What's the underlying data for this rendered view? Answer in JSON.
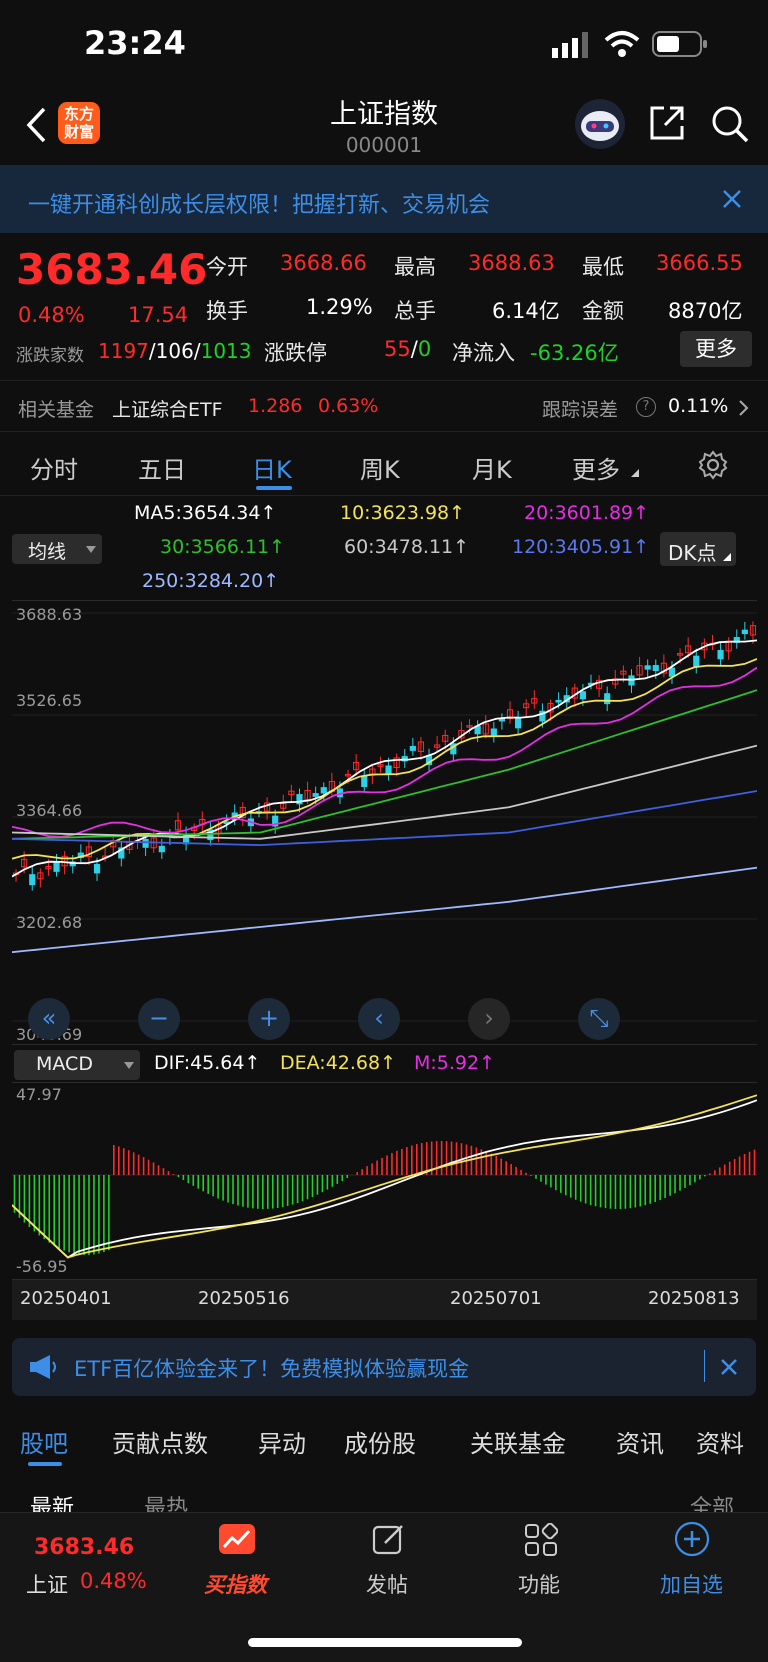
{
  "status": {
    "time": "23:24"
  },
  "header": {
    "logo_text": "东方财富",
    "title": "上证指数",
    "code": "000001"
  },
  "banner": {
    "text": "一键开通科创成长层权限！把握打新、交易机会"
  },
  "quote": {
    "price": "3683.46",
    "change_pct": "0.48%",
    "change": "17.54",
    "open_label": "今开",
    "open": "3668.66",
    "high_label": "最高",
    "high": "3688.63",
    "low_label": "最低",
    "low": "3666.55",
    "turnover_label": "换手",
    "turnover": "1.29%",
    "volume_label": "总手",
    "volume": "6.14亿",
    "amount_label": "金额",
    "amount": "8870亿",
    "breadth_label": "涨跌家数",
    "up": "1197",
    "flat": "106",
    "down": "1013",
    "limit_label": "涨跌停",
    "limit_up": "55",
    "limit_down": "0",
    "slash": "/",
    "netflow_label": "净流入",
    "netflow": "-63.26亿",
    "more": "更多"
  },
  "fund": {
    "label": "相关基金",
    "name": "上证综合ETF",
    "price": "1.286",
    "pct": "0.63%",
    "error_label": "跟踪误差",
    "error": "0.11%"
  },
  "tabs": [
    "分时",
    "五日",
    "日K",
    "周K",
    "月K",
    "更多"
  ],
  "ma": {
    "selector": "均线",
    "dk": "DK点",
    "ma5": "MA5:3654.34↑",
    "ma10": "10:3623.98↑",
    "ma20": "20:3601.89↑",
    "ma30": "30:3566.11↑",
    "ma60": "60:3478.11↑",
    "ma120": "120:3405.91↑",
    "ma250": "250:3284.20↑"
  },
  "colors": {
    "ma5": "#ffffff",
    "ma10": "#f3e35a",
    "ma20": "#e330e3",
    "ma30": "#2fbf2f",
    "ma60": "#c8c8c8",
    "ma120": "#3f5fe0",
    "ma250": "#9fb8ff",
    "up": "#ff2b2b",
    "down": "#1fd12a",
    "accent": "#3d8ee6"
  },
  "kline_axis": [
    "3688.63",
    "3526.65",
    "3364.66",
    "3202.68",
    "3040.69"
  ],
  "macd": {
    "selector": "MACD",
    "dif": "DIF:45.64↑",
    "dea": "DEA:42.68↑",
    "m": "M:5.92↑",
    "top": "47.97",
    "bottom": "-56.95"
  },
  "dates": [
    "20250401",
    "20250516",
    "20250701",
    "20250813"
  ],
  "chart_data": {
    "type": "line",
    "title": "",
    "xlabel": "",
    "ylabel": "",
    "ylim": [
      3040.69,
      3688.63
    ],
    "x": [
      "20250401",
      "20250516",
      "20250701",
      "20250813"
    ],
    "series": [
      {
        "name": "MA5",
        "values": [
          3270,
          3370,
          3520,
          3654.34
        ]
      },
      {
        "name": "10",
        "values": [
          3290,
          3365,
          3500,
          3623.98
        ]
      },
      {
        "name": "20",
        "values": [
          3340,
          3355,
          3470,
          3601.89
        ]
      },
      {
        "name": "30",
        "values": [
          3330,
          3340,
          3440,
          3566.11
        ]
      },
      {
        "name": "60",
        "values": [
          3340,
          3330,
          3380,
          3478.11
        ]
      },
      {
        "name": "120",
        "values": [
          3330,
          3320,
          3340,
          3405.91
        ]
      },
      {
        "name": "250",
        "values": [
          3150,
          3190,
          3230,
          3284.2
        ]
      }
    ]
  },
  "chart_buttons": [
    "«",
    "−",
    "+",
    "‹",
    "›",
    "⤡"
  ],
  "ad": {
    "text": "ETF百亿体验金来了！免费模拟体验赢现金"
  },
  "bottom_tabs": [
    "股吧",
    "贡献点数",
    "异动",
    "成份股",
    "关联基金",
    "资讯",
    "资料"
  ],
  "sort": {
    "latest": "最新",
    "hot": "最热",
    "filter": "全部"
  },
  "footer": {
    "price": "3683.46",
    "name": "上证",
    "pct": "0.48%",
    "buy": "买指数",
    "post": "发帖",
    "func": "功能",
    "add": "加自选"
  }
}
